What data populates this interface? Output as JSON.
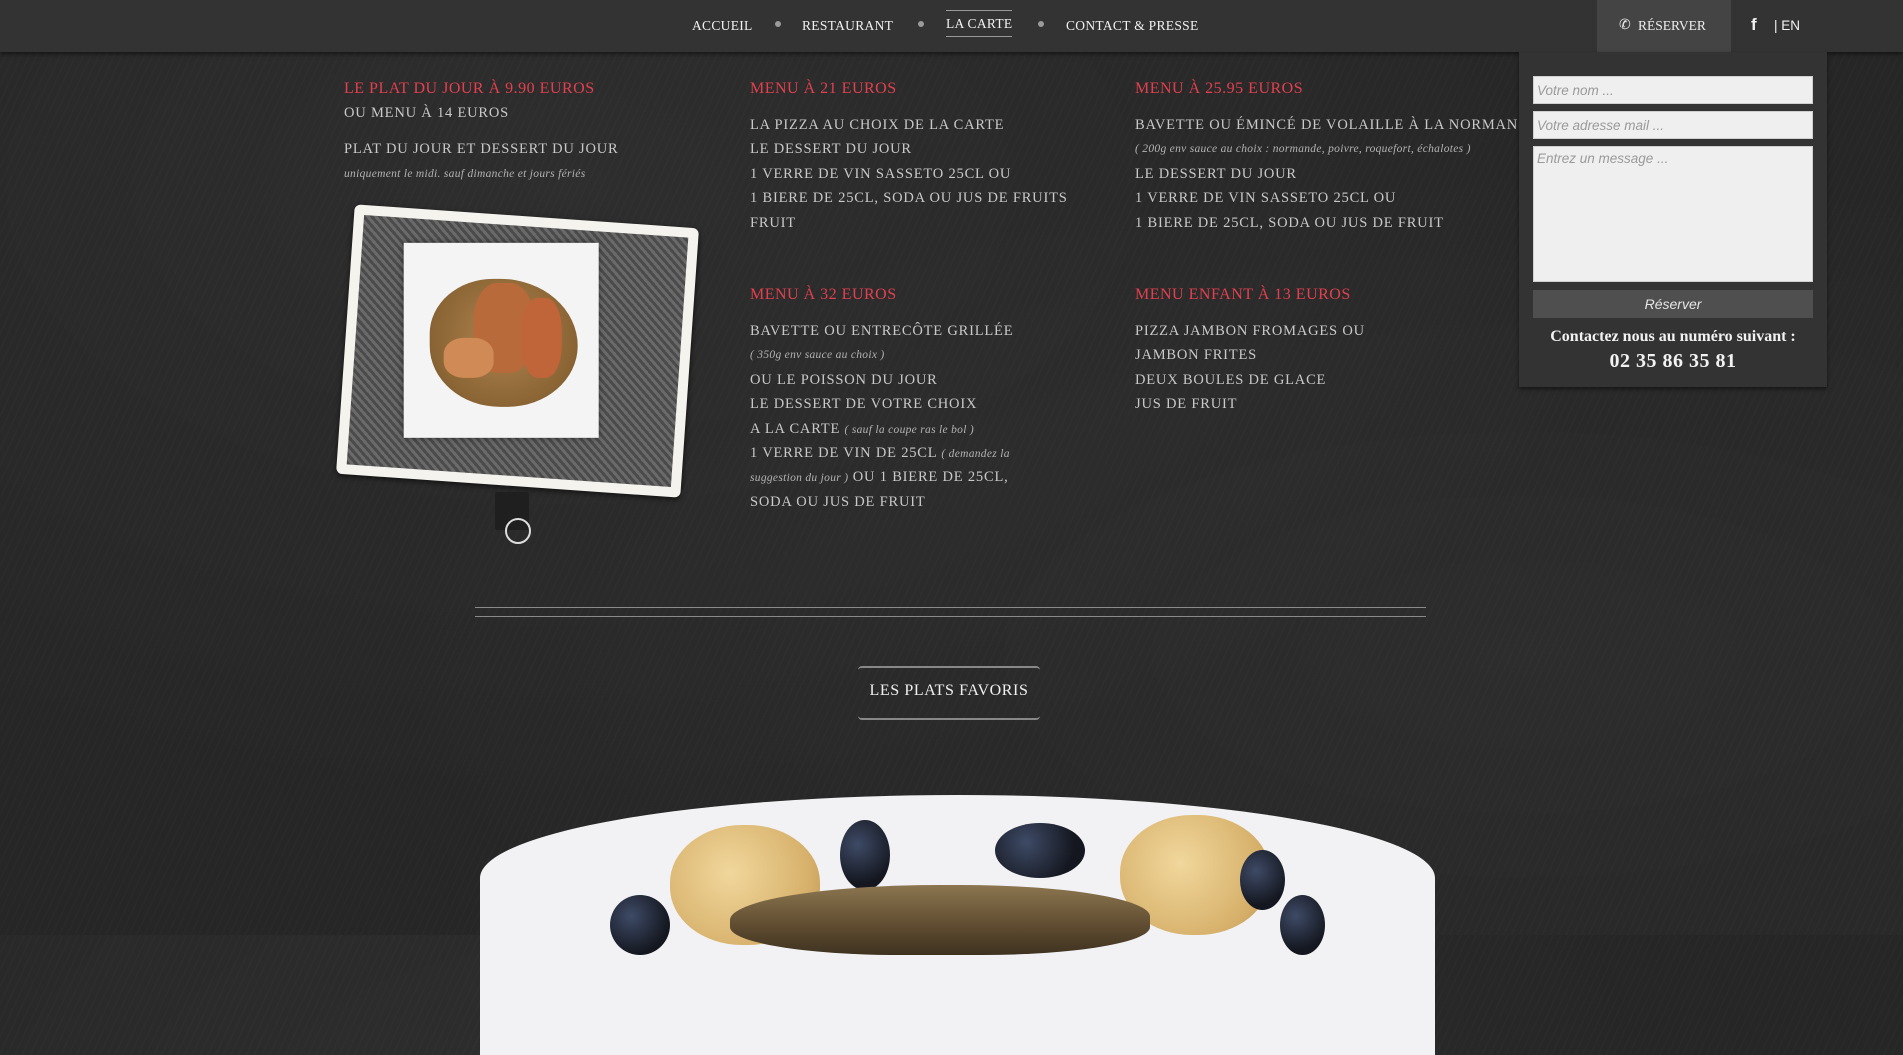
{
  "nav": {
    "items": [
      "ACCUEIL",
      "RESTAURANT",
      "LA CARTE",
      "CONTACT & PRESSE"
    ],
    "active": "LA CARTE",
    "reserve": "RÉSERVER",
    "facebook": "f",
    "lang": "| EN"
  },
  "menus": {
    "plat_du_jour": {
      "title": "LE PLAT DU JOUR À 9.90 EUROS",
      "subtitle": "OU MENU À 14 EUROS",
      "line1": "PLAT DU JOUR ET DESSERT DU JOUR",
      "note": "uniquement le midi. sauf dimanche et jours fériés"
    },
    "menu21": {
      "title": "MENU À 21 EUROS",
      "lines": [
        "LA PIZZA AU CHOIX DE LA CARTE",
        "LE DESSERT DU JOUR",
        "1 VERRE DE VIN SASSETO 25CL OU",
        "1 BIERE DE 25CL, SODA OU JUS DE FRUITS",
        "FRUIT"
      ]
    },
    "menu2595": {
      "title": "MENU À 25.95 EUROS",
      "line1": "BAVETTE OU ÉMINCÉ DE VOLAILLE À LA NORMAN",
      "note": "( 200g env sauce au choix : normande, poivre, roquefort, échalotes )",
      "lines": [
        "LE DESSERT DU JOUR",
        "1 VERRE DE VIN SASSETO 25CL OU",
        "1 BIERE DE 25CL, SODA OU JUS DE FRUIT"
      ]
    },
    "menu32": {
      "title": "MENU À 32 EUROS",
      "line1": "BAVETTE OU ENTRECÔTE GRILLÉE",
      "note1": "( 350g env sauce au choix )",
      "line2": "OU LE POISSON DU JOUR",
      "line3": "LE DESSERT DE VOTRE CHOIX",
      "line4": "A LA CARTE",
      "note2": "( sauf la coupe ras le bol )",
      "line5": "1 VERRE DE VIN DE 25CL",
      "note3": "( demandez la",
      "note4": "suggestion du jour )",
      "line6": "OU 1 BIERE DE 25CL,",
      "line7": "SODA OU JUS DE FRUIT"
    },
    "enfant": {
      "title": "MENU ENFANT À 13 EUROS",
      "lines": [
        "PIZZA JAMBON FROMAGES OU",
        "JAMBON FRITES",
        "DEUX BOULES DE GLACE",
        "JUS DE FRUIT"
      ]
    }
  },
  "favorites_title": "LES PLATS FAVORIS",
  "reservation": {
    "name_placeholder": "Votre nom ...",
    "email_placeholder": "Votre adresse mail ...",
    "message_placeholder": "Entrez un message ...",
    "submit": "Réserver",
    "contact_label": "Contactez nous au numéro suivant :",
    "phone": "02 35 86 35 81"
  },
  "colors": {
    "accent": "#e2404e",
    "topbar": "#333333",
    "background": "#262626"
  }
}
